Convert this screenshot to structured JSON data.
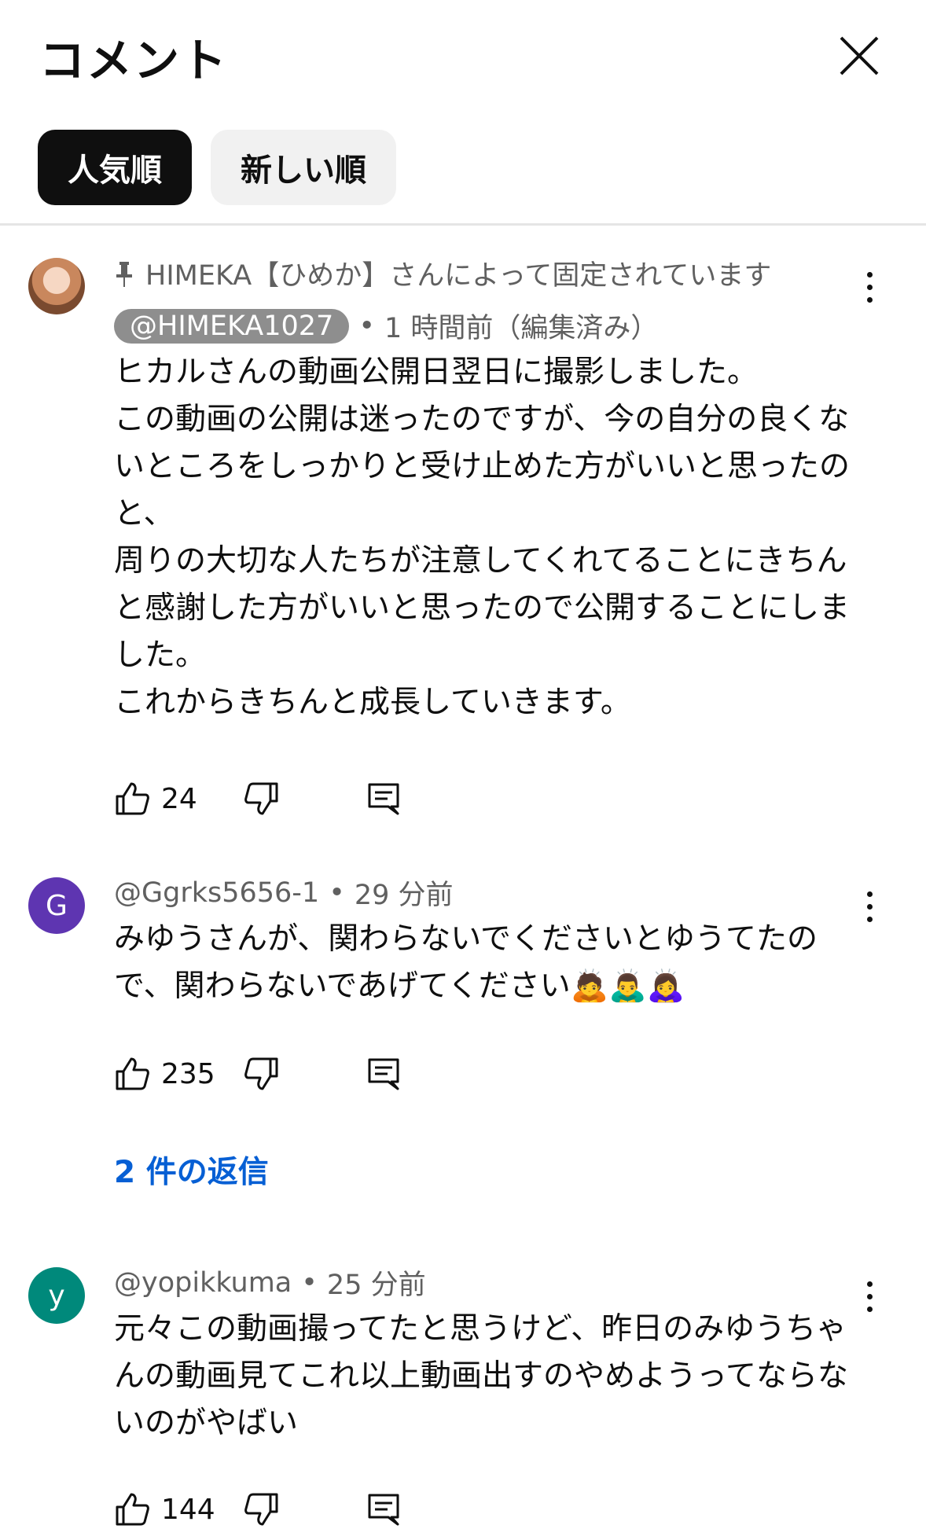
{
  "header": {
    "title": "コメント"
  },
  "tabs": [
    {
      "label": "人気順",
      "active": true
    },
    {
      "label": "新しい順",
      "active": false
    }
  ],
  "comments": [
    {
      "pinned_text": "HIMEKA【ひめか】さんによって固定されています",
      "handle": "@HIMEKA1027",
      "time": "1 時間前（編集済み）",
      "avatar": "photo",
      "text": "ヒカルさんの動画公開日翌日に撮影しました。\nこの動画の公開は迷ったのですが、今の自分の良くな\nいところをしっかりと受け止めた方がいいと思ったの\nと、\n周りの大切な人たちが注意してくれてることにきちん\nと感謝した方がいいと思ったので公開することにしま\nした。\nこれからきちんと成長していきます。",
      "likes": "24"
    },
    {
      "handle": "@Ggrks5656-1",
      "time": "29 分前",
      "avatar_letter": "G",
      "avatar_color": "#5e35b1",
      "text": "みゆうさんが、関わらないでくださいとゆうてたの\nで、関わらないであげてください🙇🙇‍♂️🙇‍♀️",
      "likes": "235",
      "replies": "2 件の返信"
    },
    {
      "handle": "@yopikkuma",
      "time": "25 分前",
      "avatar_letter": "y",
      "avatar_color": "#00897b",
      "text": "元々この動画撮ってたと思うけど、昨日のみゆうちゃ\nんの動画見てこれ以上動画出すのやめようってならな\nいのがやばい",
      "likes": "144"
    }
  ],
  "icons": {
    "close": "close-icon",
    "pin": "pin-icon",
    "like": "thumb-up-icon",
    "dislike": "thumb-down-icon",
    "reply": "reply-icon",
    "more": "more-vert-icon"
  },
  "colors": {
    "link": "#065fd4",
    "active_chip": "#0f0f0f"
  }
}
